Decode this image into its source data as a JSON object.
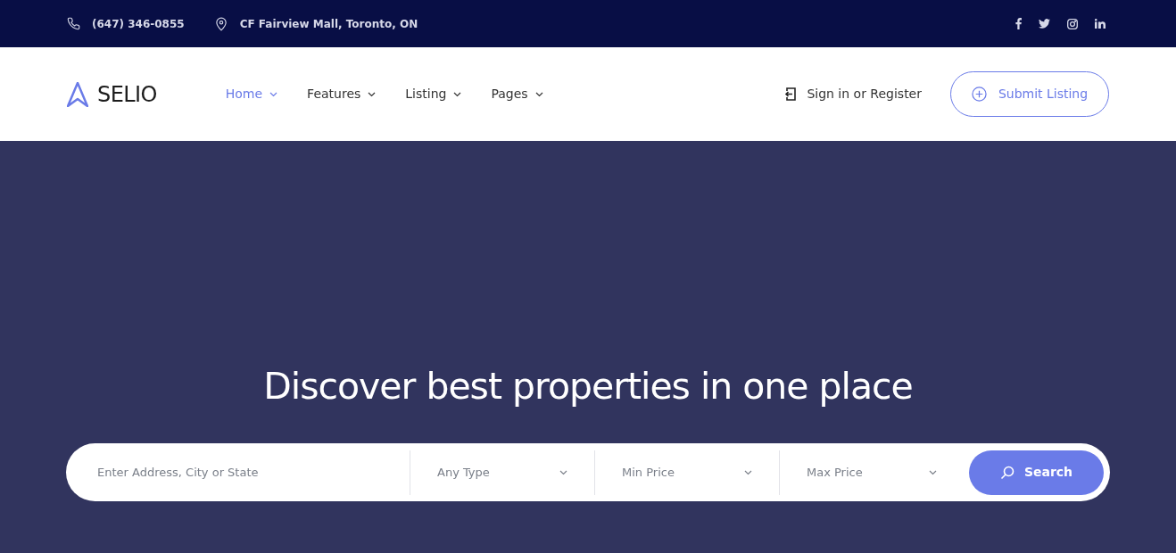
{
  "topbar": {
    "phone": "(647) 346-0855",
    "address": "CF Fairview Mall, Toronto, ON",
    "social": [
      {
        "kind": "facebook"
      },
      {
        "kind": "twitter"
      },
      {
        "kind": "instagram"
      },
      {
        "kind": "linkedin"
      }
    ]
  },
  "header": {
    "logo": "SELIO",
    "nav": [
      {
        "label": "Home",
        "selected": true
      },
      {
        "label": "Features",
        "selected": false
      },
      {
        "label": "Listing",
        "selected": false
      },
      {
        "label": "Pages",
        "selected": false
      }
    ],
    "signin": "Sign in or Register",
    "submit": "Submit Listing"
  },
  "hero": {
    "title": "Discover best properties in one place",
    "search": {
      "placeholder": "Enter Address, City or State",
      "selects": [
        "Any Type",
        "Min Price",
        "Max Price"
      ],
      "button": "Search"
    }
  }
}
